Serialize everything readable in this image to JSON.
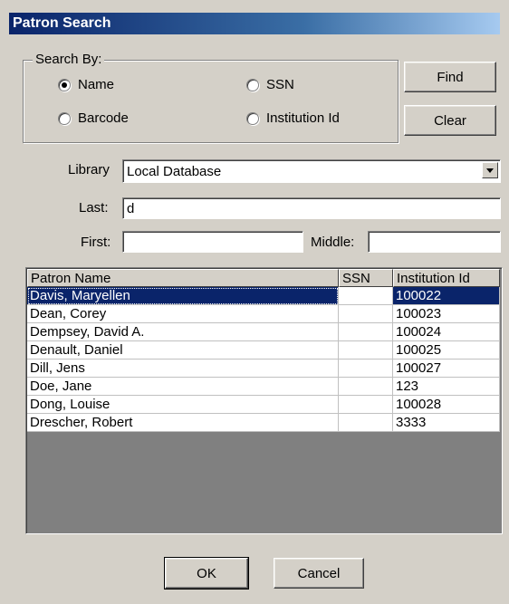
{
  "window": {
    "title": "Patron Search"
  },
  "search_by": {
    "legend": "Search By:",
    "options": [
      {
        "label": "Name",
        "selected": true
      },
      {
        "label": "SSN",
        "selected": false
      },
      {
        "label": "Barcode",
        "selected": false
      },
      {
        "label": "Institution Id",
        "selected": false
      }
    ]
  },
  "buttons": {
    "find": "Find",
    "clear": "Clear",
    "ok": "OK",
    "cancel": "Cancel"
  },
  "form": {
    "library_label": "Library",
    "library_value": "Local Database",
    "last_label": "Last:",
    "last_value": "d",
    "first_label": "First:",
    "first_value": "",
    "middle_label": "Middle:",
    "middle_value": ""
  },
  "table": {
    "columns": [
      "Patron Name",
      "SSN",
      "Institution Id"
    ],
    "rows": [
      {
        "name": "Davis, Maryellen",
        "ssn": "",
        "id": "100022",
        "selected": true
      },
      {
        "name": "Dean, Corey",
        "ssn": "",
        "id": "100023"
      },
      {
        "name": "Dempsey, David A.",
        "ssn": "",
        "id": "100024"
      },
      {
        "name": "Denault, Daniel",
        "ssn": "",
        "id": "100025"
      },
      {
        "name": "Dill, Jens",
        "ssn": "",
        "id": "100027"
      },
      {
        "name": "Doe, Jane",
        "ssn": "",
        "id": "123"
      },
      {
        "name": "Dong, Louise",
        "ssn": "",
        "id": "100028"
      },
      {
        "name": "Drescher, Robert",
        "ssn": "",
        "id": "3333"
      }
    ]
  },
  "colors": {
    "title_bar": "#0a246a",
    "selection": "#0a246a",
    "face": "#d4d0c8"
  },
  "icons": {
    "combo": "triangle-down-icon"
  }
}
